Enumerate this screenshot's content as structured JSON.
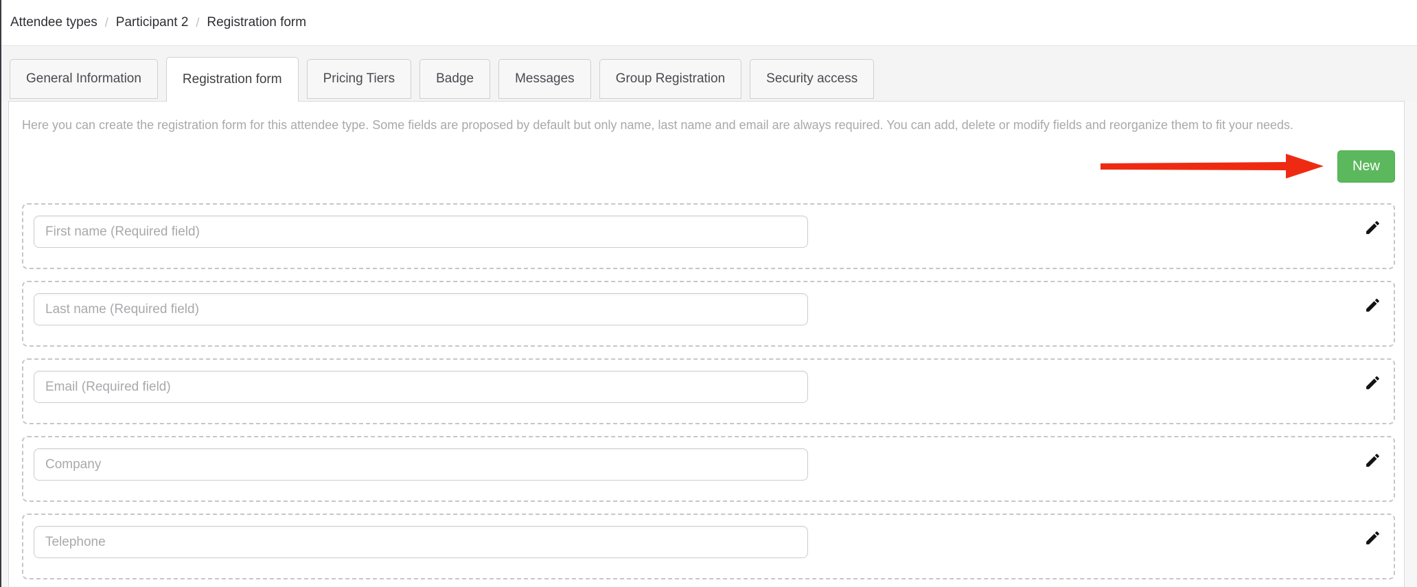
{
  "breadcrumb": {
    "separator": "/",
    "items": [
      {
        "label": "Attendee types"
      },
      {
        "label": "Participant 2"
      },
      {
        "label": "Registration form"
      }
    ]
  },
  "tabs": [
    {
      "label": "General Information"
    },
    {
      "label": "Registration form"
    },
    {
      "label": "Pricing Tiers"
    },
    {
      "label": "Badge"
    },
    {
      "label": "Messages"
    },
    {
      "label": "Group Registration"
    },
    {
      "label": "Security access"
    }
  ],
  "active_tab": "Registration form",
  "content": {
    "description": "Here you can create the registration form for this attendee type. Some fields are proposed by default but only name, last name and email are always required. You can add, delete or modify fields and reorganize them to fit your needs.",
    "new_button_label": "New"
  },
  "fields": [
    {
      "placeholder": "First name (Required field)"
    },
    {
      "placeholder": "Last name (Required field)"
    },
    {
      "placeholder": "Email (Required field)"
    },
    {
      "placeholder": "Company"
    },
    {
      "placeholder": "Telephone"
    }
  ],
  "icons": {
    "field_action": "pencil-icon",
    "annotation": "red-arrow-icon"
  },
  "colors": {
    "accent_green": "#5cb85c",
    "accent_green_border": "#4cae4c",
    "annotation_red": "#ee2b12",
    "dashed_border": "#c6c6c9",
    "muted_text": "#a9a9ad",
    "tabstrip_background": "#f4f4f5"
  }
}
